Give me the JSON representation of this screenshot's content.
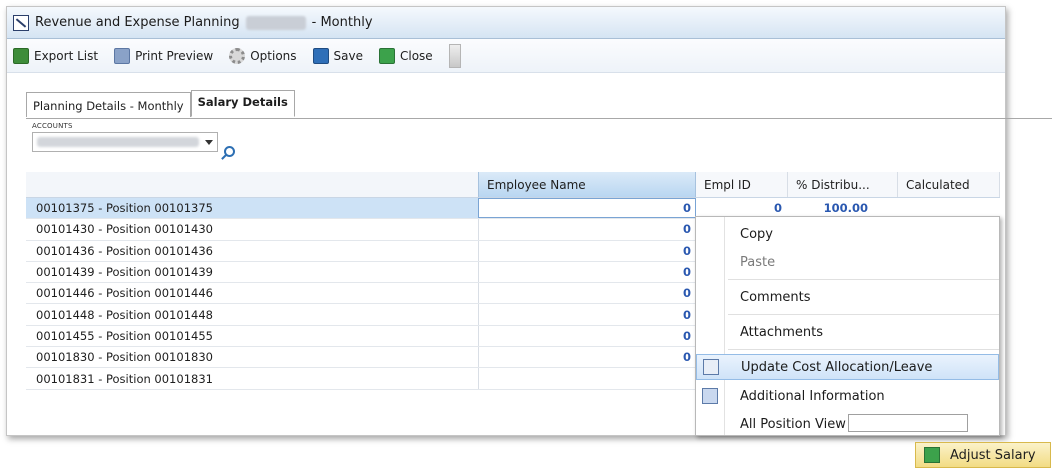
{
  "window": {
    "title_prefix": "Revenue and Expense Planning",
    "title_suffix": "- Monthly"
  },
  "toolbar": {
    "items": [
      {
        "label": "Export List",
        "icon": "excel-export-icon"
      },
      {
        "label": "Print Preview",
        "icon": "printer-icon"
      },
      {
        "label": "Options",
        "icon": "gear-icon"
      },
      {
        "label": "Save",
        "icon": "floppy-disk-icon"
      },
      {
        "label": "Close",
        "icon": "close-door-icon"
      }
    ]
  },
  "tabs": [
    {
      "label": "Planning Details - Monthly",
      "active": false
    },
    {
      "label": "Salary Details",
      "active": true
    }
  ],
  "accounts": {
    "label": "ACCOUNTS"
  },
  "grid": {
    "columns": [
      "Employee Name",
      "Empl ID",
      "% Distribu...",
      "Calculated"
    ],
    "rows": [
      {
        "position": "00101375 - Position 00101375",
        "employee": "0",
        "empl_id": "0",
        "distribution": "100.00"
      },
      {
        "position": "00101430 - Position 00101430",
        "employee": "0"
      },
      {
        "position": "00101436 - Position 00101436",
        "employee": "0"
      },
      {
        "position": "00101439 - Position 00101439",
        "employee": "0"
      },
      {
        "position": "00101446 - Position 00101446",
        "employee": "0"
      },
      {
        "position": "00101448 - Position 00101448",
        "employee": "0"
      },
      {
        "position": "00101455 - Position 00101455",
        "employee": "0"
      },
      {
        "position": "00101830 - Position 00101830",
        "employee": "0"
      },
      {
        "position": "00101831 - Position 00101831",
        "employee": ""
      }
    ]
  },
  "context_menu": {
    "copy": "Copy",
    "paste": "Paste",
    "comments": "Comments",
    "attachments": "Attachments",
    "update_cost": "Update Cost Allocation/Leave",
    "additional_info": "Additional Information",
    "position_view": "All Position View"
  },
  "adjust_salary": {
    "label": "Adjust Salary"
  },
  "colors": {
    "accent": "#2a58b0",
    "selected_row": "#cde2f6",
    "highlight": "#cfe3f8"
  }
}
